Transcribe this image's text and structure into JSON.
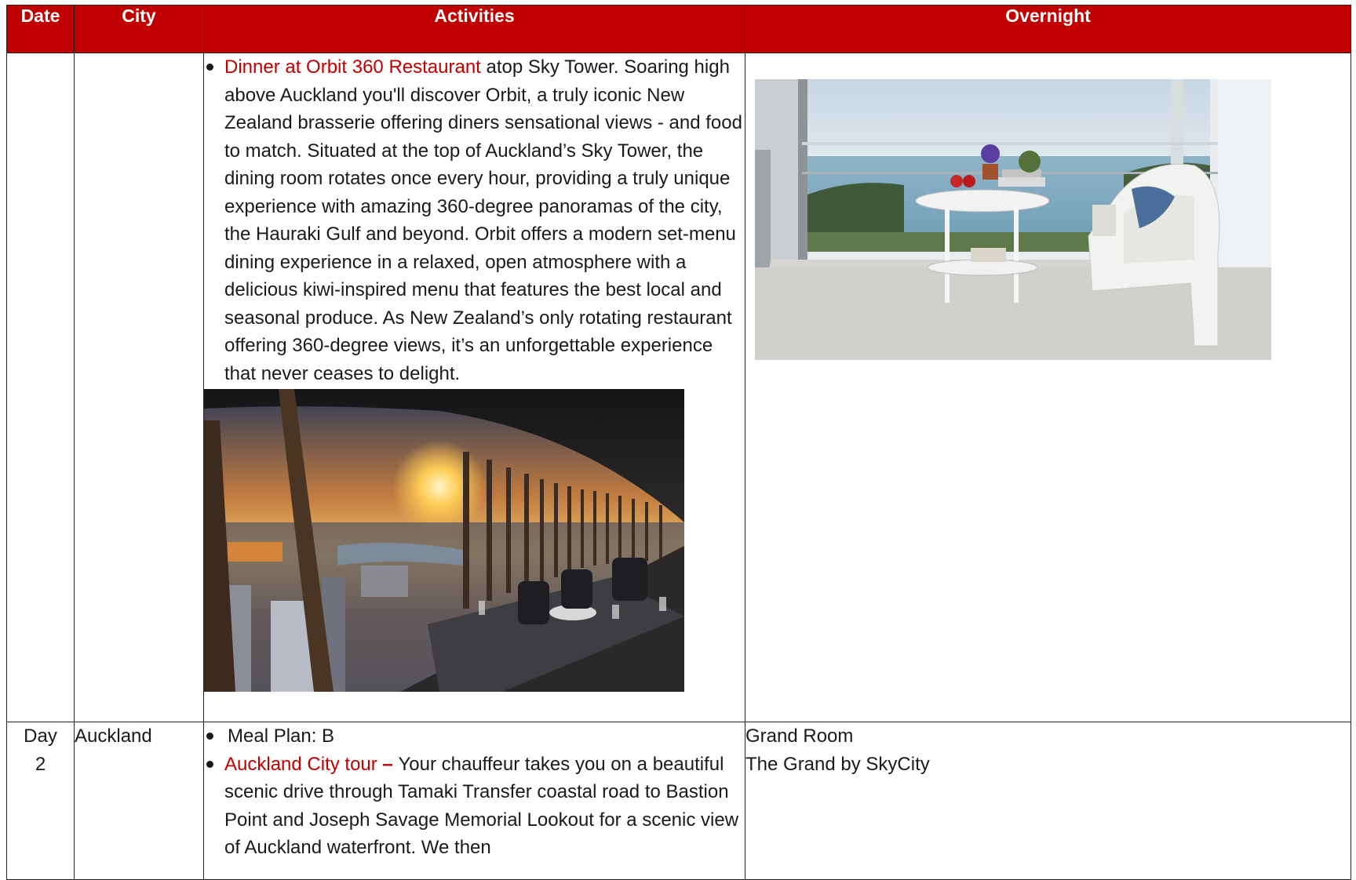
{
  "headers": {
    "date": "Date",
    "city": "City",
    "activities": "Activities",
    "overnight": "Overnight"
  },
  "row1": {
    "orbit_link": "Dinner at Orbit 360 Restaurant",
    "orbit_text": " atop Sky Tower. Soaring high above Auckland you'll discover Orbit, a truly iconic New Zealand brasserie offering diners sensational views - and food to match. Situated at the top of Auckland’s Sky Tower, the dining room rotates once every hour, providing a truly unique experience with amazing 360-degree panoramas of the city, the Hauraki Gulf and beyond. Orbit offers a modern set-menu dining experience in a relaxed, open atmosphere with a delicious kiwi-inspired menu that features the best local and seasonal produce. As New Zealand’s only rotating restaurant offering 360-degree views, it’s an unforgettable experience that never ceases to delight."
  },
  "row2": {
    "day_word": "Day",
    "day_num": "2",
    "city": "Auckland",
    "meal_plan": "Meal Plan: B",
    "tour_link": "Auckland City tour",
    "tour_dash": " – ",
    "tour_text": "Your chauffeur takes you on a beautiful scenic drive through Tamaki Transfer coastal road to Bastion Point and Joseph Savage Memorial Lookout for a scenic view of Auckland waterfront. We then",
    "room": "Grand Room",
    "hotel": "The Grand by SkyCity"
  },
  "colors": {
    "header_bg": "#c00000",
    "link": "#c00000"
  }
}
